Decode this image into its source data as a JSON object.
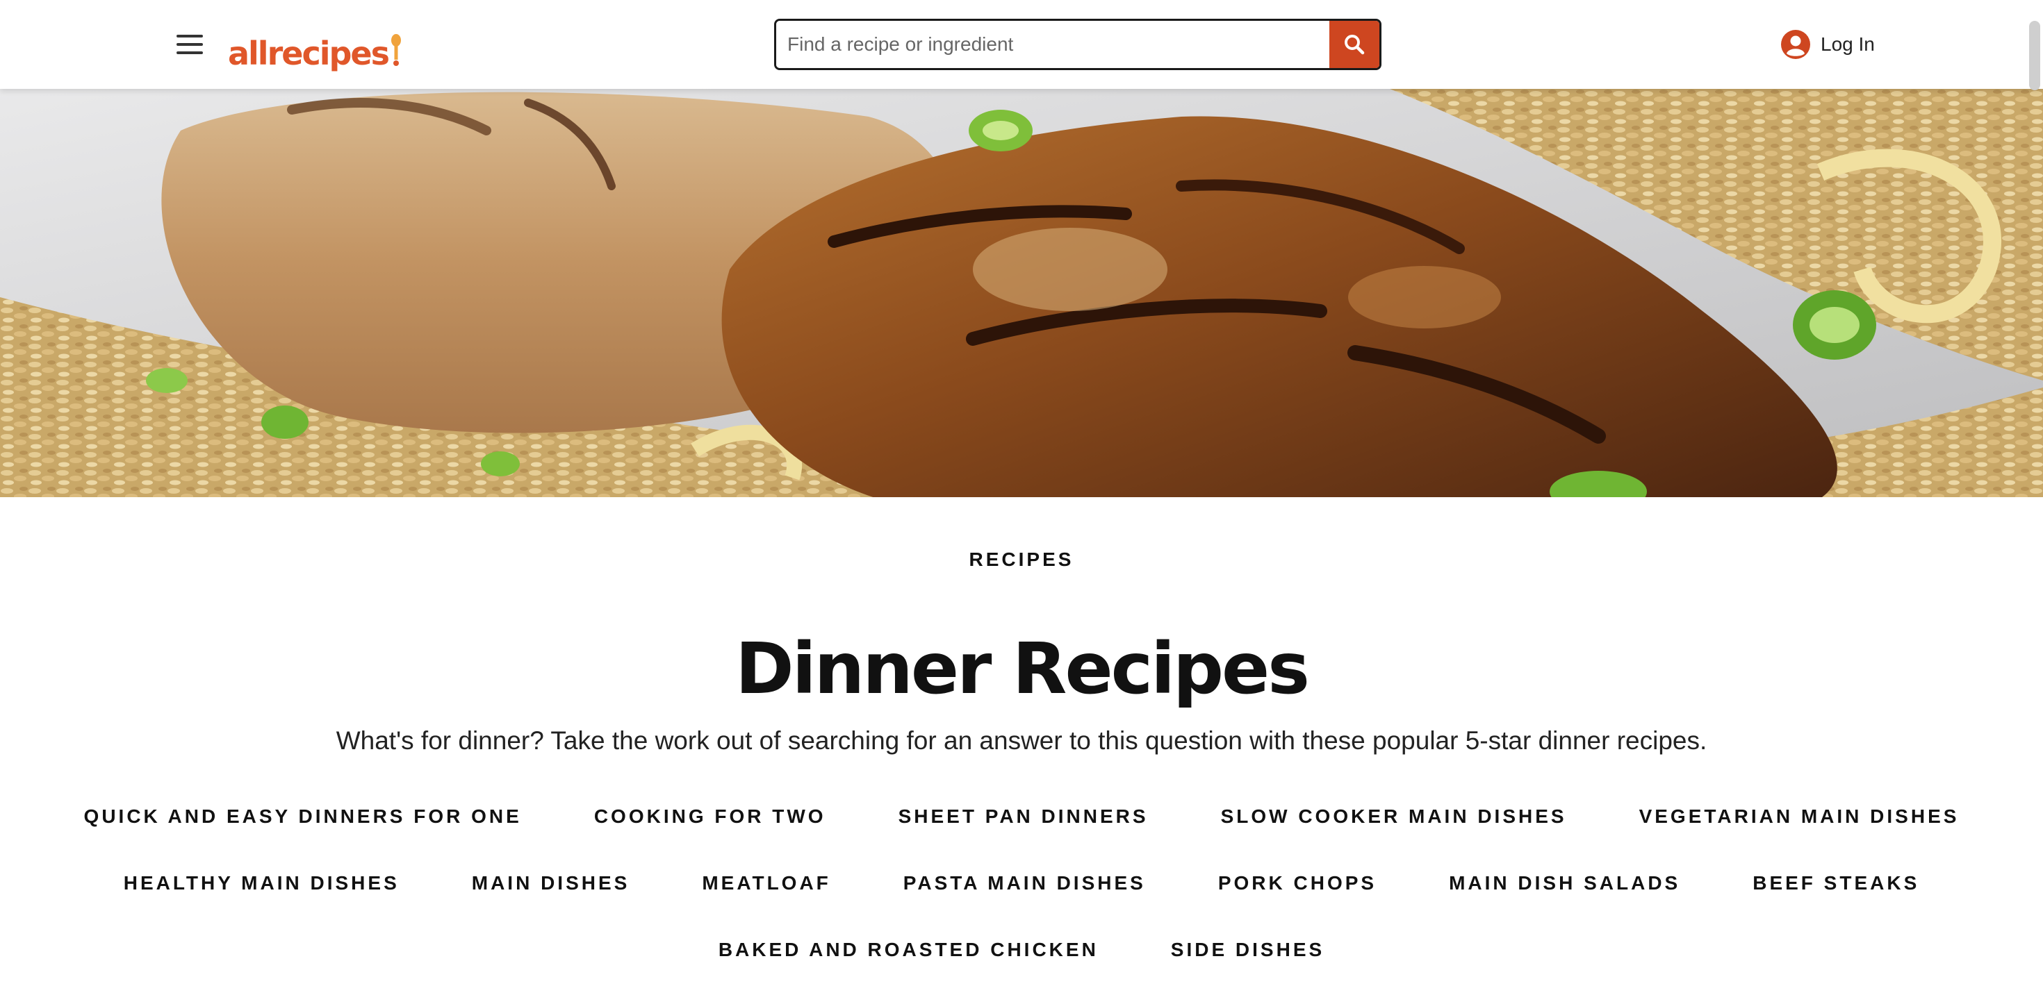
{
  "header": {
    "logo_text": "allrecipes",
    "search": {
      "placeholder": "Find a recipe or ingredient",
      "value": ""
    },
    "login_label": "Log In",
    "colors": {
      "brand": "#e0572a",
      "search_button": "#ce4620",
      "account_icon": "#ce4620"
    },
    "icons": [
      "menu-icon",
      "search-icon",
      "account-icon"
    ]
  },
  "hero": {
    "description": "Grilled glazed chicken breast sliced over fried rice with green onions"
  },
  "breadcrumb": "RECIPES",
  "page_title": "Dinner Recipes",
  "description": "What's for dinner? Take the work out of searching for an answer to this question with these popular 5-star dinner recipes.",
  "taxonomy_links": [
    [
      "QUICK AND EASY DINNERS FOR ONE",
      "COOKING FOR TWO",
      "SHEET PAN DINNERS",
      "SLOW COOKER MAIN DISHES",
      "VEGETARIAN MAIN DISHES"
    ],
    [
      "HEALTHY MAIN DISHES",
      "MAIN DISHES",
      "MEATLOAF",
      "PASTA MAIN DISHES",
      "PORK CHOPS",
      "MAIN DISH SALADS",
      "BEEF STEAKS"
    ],
    [
      "BAKED AND ROASTED CHICKEN",
      "SIDE DISHES"
    ]
  ]
}
